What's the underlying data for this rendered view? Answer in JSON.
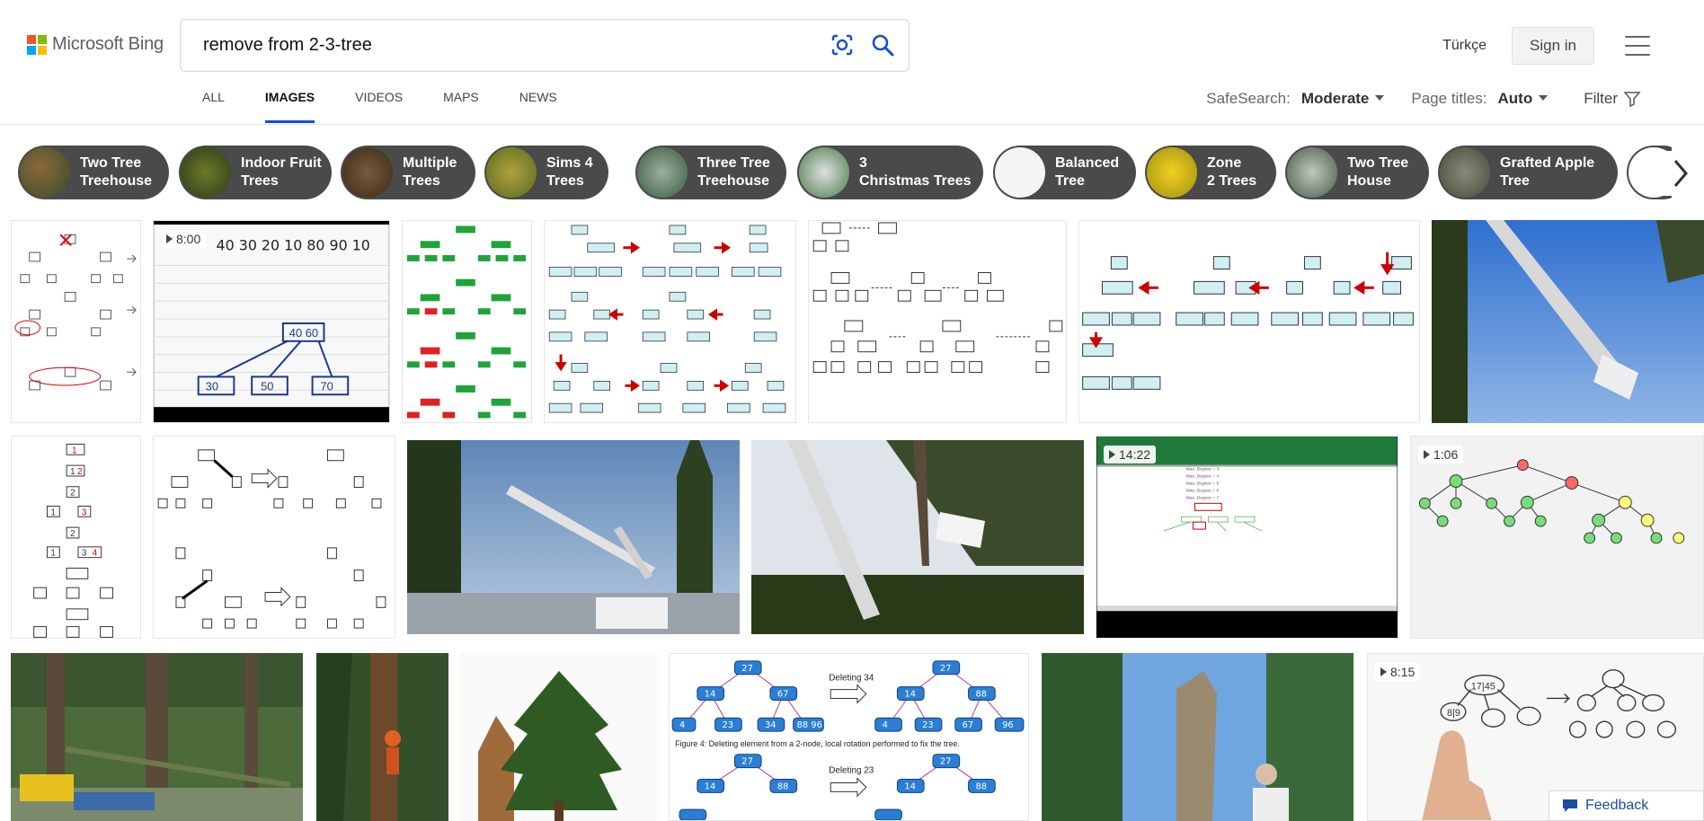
{
  "brand": {
    "name": "Microsoft Bing",
    "colors": [
      "#f35325",
      "#81bc06",
      "#05a6f0",
      "#ffba08"
    ]
  },
  "search": {
    "query": "remove from 2-3-tree"
  },
  "header": {
    "language": "Türkçe",
    "signin_label": "Sign in"
  },
  "tabs": [
    {
      "label": "ALL",
      "active": false
    },
    {
      "label": "IMAGES",
      "active": true
    },
    {
      "label": "VIDEOS",
      "active": false
    },
    {
      "label": "MAPS",
      "active": false
    },
    {
      "label": "NEWS",
      "active": false
    }
  ],
  "filters": {
    "safesearch_label": "SafeSearch:",
    "safesearch_value": "Moderate",
    "pagetitles_label": "Page titles:",
    "pagetitles_value": "Auto",
    "filter_label": "Filter"
  },
  "related": [
    {
      "line1": "Two Tree",
      "line2": "Treehouse"
    },
    {
      "line1": "Indoor Fruit",
      "line2": "Trees"
    },
    {
      "line1": "Multiple",
      "line2": "Trees"
    },
    {
      "line1": "Sims 4",
      "line2": "Trees"
    },
    {
      "line1": "Three Tree",
      "line2": "Treehouse"
    },
    {
      "line1": "3",
      "line2": "Christmas Trees"
    },
    {
      "line1": "Balanced",
      "line2": "Tree"
    },
    {
      "line1": "Zone",
      "line2": "2 Trees"
    },
    {
      "line1": "Two Tree",
      "line2": "House"
    },
    {
      "line1": "Grafted Apple",
      "line2": "Tree"
    }
  ],
  "videos": {
    "v1": "8:00",
    "v2": "14:22",
    "v3": "1:06",
    "v4": "8:15"
  },
  "captions": {
    "fig4": "Figure 4: Deleting element from a 2-node, local rotation performed to fix the tree.",
    "deleting34": "Deleting 34",
    "deleting23": "Deleting 23"
  },
  "feedback_label": "Feedback"
}
